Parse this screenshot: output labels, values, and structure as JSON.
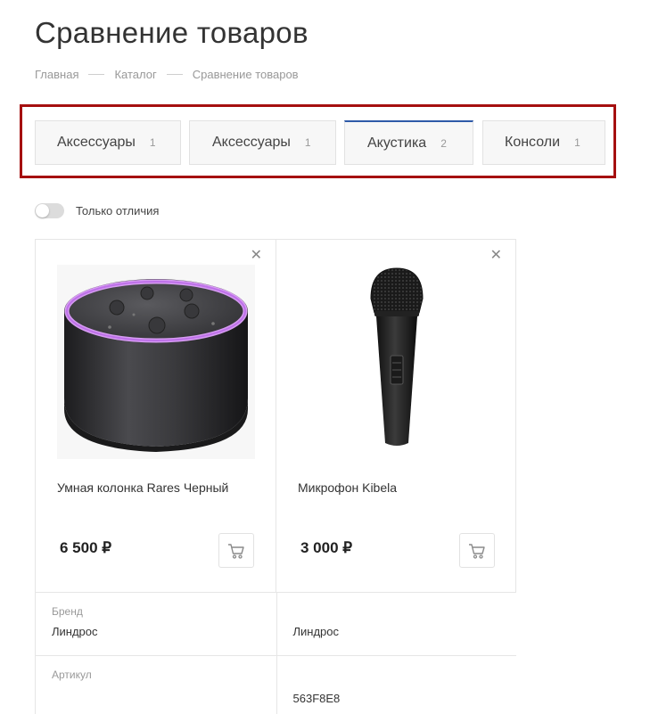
{
  "page": {
    "title": "Сравнение товаров"
  },
  "breadcrumb": [
    {
      "label": "Главная"
    },
    {
      "label": "Каталог"
    },
    {
      "label": "Сравнение товаров"
    }
  ],
  "tabs": [
    {
      "label": "Аксессуары",
      "count": "1"
    },
    {
      "label": "Аксессуары",
      "count": "1"
    },
    {
      "label": "Акустика",
      "count": "2"
    },
    {
      "label": "Консоли",
      "count": "1"
    }
  ],
  "active_tab": "Акустика",
  "filter": {
    "label": "Только отличия",
    "enabled": false
  },
  "products": [
    {
      "name": "Умная колонка Rares Черный",
      "price": "6 500 ₽",
      "image": "smart-speaker"
    },
    {
      "name": "Микрофон Kibela",
      "price": "3 000 ₽",
      "image": "microphone"
    }
  ],
  "properties": [
    {
      "name": "Бренд",
      "values": [
        "Линдрос",
        "Линдрос"
      ]
    },
    {
      "name": "Артикул",
      "values": [
        "",
        "563F8E8"
      ]
    }
  ],
  "icons": {
    "close": "close-icon",
    "cart": "cart-icon"
  },
  "colors": {
    "accent": "#2e5aa8",
    "highlight_frame": "#a50f0f"
  }
}
